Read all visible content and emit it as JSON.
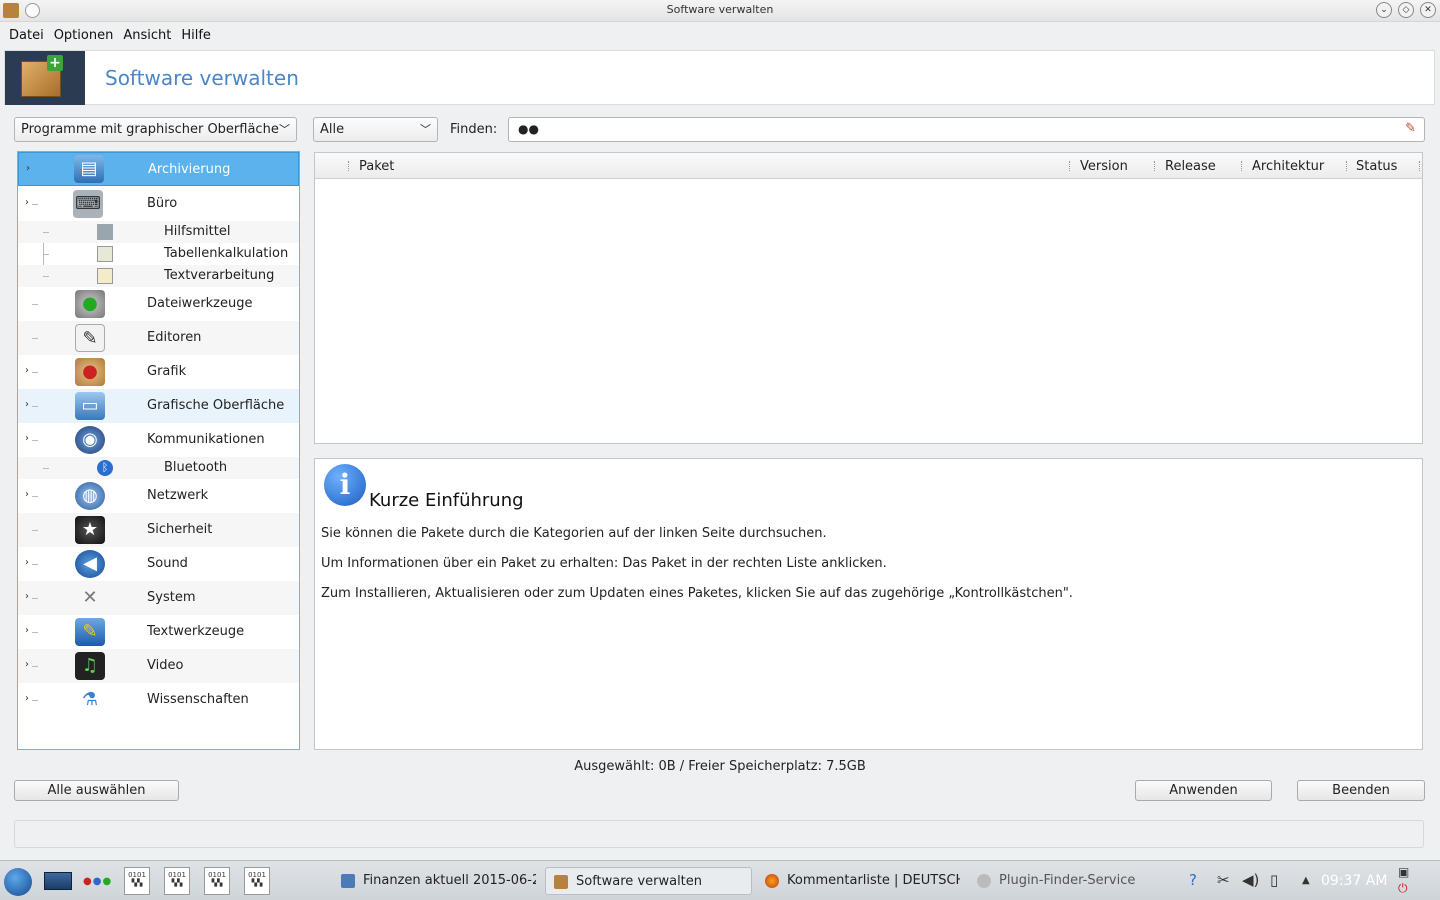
{
  "window": {
    "title": "Software verwalten"
  },
  "menu": [
    "Datei",
    "Optionen",
    "Ansicht",
    "Hilfe"
  ],
  "banner": {
    "title": "Software verwalten"
  },
  "filters": {
    "category_filter": "Programme mit graphischer Oberfläche",
    "status_filter": "Alle",
    "find_label": "Finden:",
    "find_value": ""
  },
  "tree": {
    "items": [
      {
        "label": "Archivierung",
        "icon": "archive-icon"
      },
      {
        "label": "Büro",
        "icon": "office-icon"
      },
      {
        "label": "Hilfsmittel",
        "icon": "utilities-icon"
      },
      {
        "label": "Tabellenkalkulation",
        "icon": "spreadsheet-icon"
      },
      {
        "label": "Textverarbeitung",
        "icon": "wordprocessor-icon"
      },
      {
        "label": "Dateiwerkzeuge",
        "icon": "harddisk-icon"
      },
      {
        "label": "Editoren",
        "icon": "editor-icon"
      },
      {
        "label": "Grafik",
        "icon": "palette-icon"
      },
      {
        "label": "Grafische Oberfläche",
        "icon": "desktop-icon"
      },
      {
        "label": "Kommunikationen",
        "icon": "communication-icon"
      },
      {
        "label": "Bluetooth",
        "icon": "bluetooth-icon"
      },
      {
        "label": "Netzwerk",
        "icon": "network-icon"
      },
      {
        "label": "Sicherheit",
        "icon": "security-icon"
      },
      {
        "label": "Sound",
        "icon": "speaker-icon"
      },
      {
        "label": "System",
        "icon": "tools-icon"
      },
      {
        "label": "Textwerkzeuge",
        "icon": "text-tools-icon"
      },
      {
        "label": "Video",
        "icon": "video-icon"
      },
      {
        "label": "Wissenschaften",
        "icon": "flask-icon"
      }
    ]
  },
  "table": {
    "columns": [
      "Paket",
      "Version",
      "Release",
      "Architektur",
      "Status"
    ],
    "rows": []
  },
  "info": {
    "title": "Kurze Einführung",
    "paragraphs": [
      "Sie können die Pakete durch die Kategorien auf der linken Seite durchsuchen.",
      "Um Informationen über ein Paket zu erhalten: Das Paket in der rechten Liste anklicken.",
      "Zum Installieren, Aktualisieren oder zum Updaten eines Paketes, klicken Sie auf das zugehörige „Kontrollkästchen\"."
    ]
  },
  "status_text": "Ausgewählt: 0B / Freier Speicherplatz: 7.5GB",
  "buttons": {
    "select_all": "Alle auswählen",
    "apply": "Anwenden",
    "quit": "Beenden"
  },
  "taskbar": {
    "tasks": [
      "Finanzen aktuell 2015-06-2",
      "Software verwalten",
      "Kommentarliste | DEUTSCHE",
      "Plugin-Finder-Service"
    ],
    "clock": "09:37 AM"
  }
}
